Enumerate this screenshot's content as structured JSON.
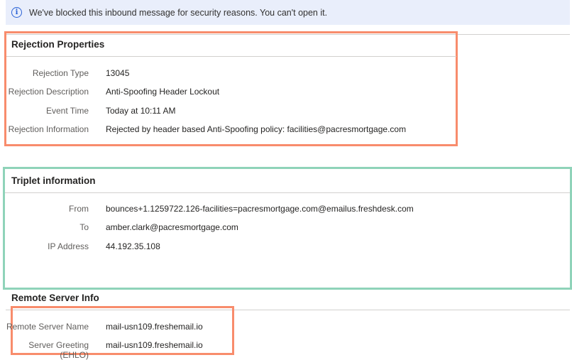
{
  "banner": {
    "icon": "info-icon",
    "text": "We've blocked this inbound message for security reasons. You can't open it."
  },
  "rejection": {
    "title": "Rejection Properties",
    "rows": [
      {
        "label": "Rejection Type",
        "value": "13045"
      },
      {
        "label": "Rejection Description",
        "value": "Anti-Spoofing Header Lockout"
      },
      {
        "label": "Event Time",
        "value": "Today at 10:11 AM"
      },
      {
        "label": "Rejection Information",
        "value": "Rejected by header based Anti-Spoofing policy: facilities@pacresmortgage.com"
      }
    ]
  },
  "triplet": {
    "title": "Triplet information",
    "rows": [
      {
        "label": "From",
        "value": "bounces+1.1259722.126-facilities=pacresmortgage.com@emailus.freshdesk.com"
      },
      {
        "label": "To",
        "value": "amber.clark@pacresmortgage.com"
      },
      {
        "label": "IP Address",
        "value": "44.192.35.108"
      }
    ]
  },
  "remote": {
    "title": "Remote Server Info",
    "rows": [
      {
        "label": "Remote Server Name",
        "value": "mail-usn109.freshemail.io"
      },
      {
        "label": "Server Greeting (EHLO)",
        "value": "mail-usn109.freshemail.io"
      }
    ]
  },
  "colors": {
    "highlight_orange": "#f88c6c",
    "highlight_green": "#8fd3b9",
    "banner_bg": "#e9eefb"
  }
}
